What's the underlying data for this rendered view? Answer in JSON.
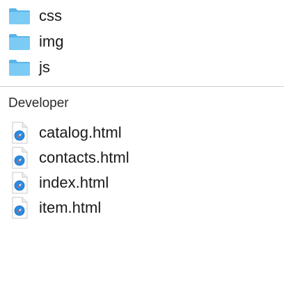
{
  "folders": [
    {
      "label": "css",
      "icon": "folder-icon"
    },
    {
      "label": "img",
      "icon": "folder-icon"
    },
    {
      "label": "js",
      "icon": "folder-icon"
    }
  ],
  "section": {
    "title": "Developer"
  },
  "files": [
    {
      "label": "catalog.html",
      "icon": "safari-html-file-icon"
    },
    {
      "label": "contacts.html",
      "icon": "safari-html-file-icon"
    },
    {
      "label": "index.html",
      "icon": "safari-html-file-icon"
    },
    {
      "label": "item.html",
      "icon": "safari-html-file-icon"
    }
  ],
  "colors": {
    "folder": "#6cc3f2",
    "folder_tab": "#5ab4e8",
    "compass": "#2c8be0",
    "divider": "#cfcfcf"
  }
}
